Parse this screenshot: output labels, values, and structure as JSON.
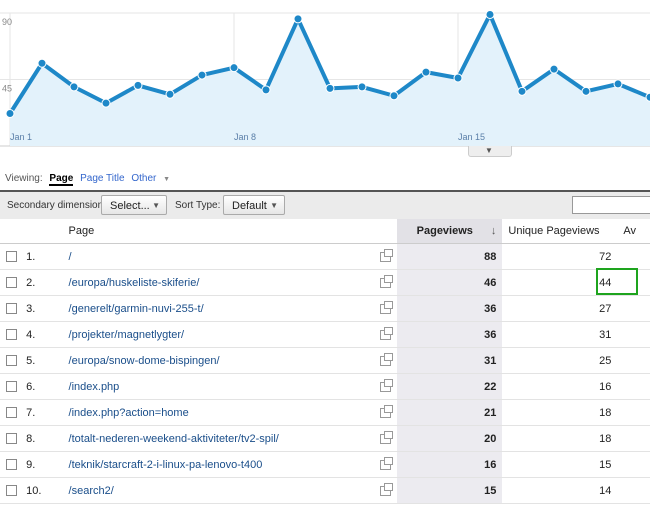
{
  "chart_data": {
    "type": "area",
    "ytick_labels": [
      "90",
      "45"
    ],
    "ylim": [
      0,
      90
    ],
    "xtick_labels": [
      "Jan 1",
      "Jan 8",
      "Jan 15"
    ],
    "values": [
      22,
      56,
      40,
      29,
      41,
      35,
      48,
      53,
      38,
      86,
      39,
      40,
      34,
      50,
      46,
      89,
      37,
      52,
      37,
      42,
      33
    ],
    "colors": {
      "line": "#1e88c8",
      "fill": "#e3f2fb"
    }
  },
  "viewing": {
    "label": "Viewing:",
    "page": "Page",
    "page_title": "Page Title",
    "other": "Other"
  },
  "toolbar": {
    "secondary_label": "Secondary dimension:",
    "secondary_value": "Select...",
    "sort_label": "Sort Type:",
    "sort_value": "Default"
  },
  "table": {
    "headers": {
      "page": "Page",
      "pageviews": "Pageviews",
      "unique": "Unique Pageviews",
      "avg": "Av"
    },
    "rows": [
      {
        "num": "1.",
        "page": "/",
        "pageviews": "88",
        "unique": "72"
      },
      {
        "num": "2.",
        "page": "/europa/huskeliste-skiferie/",
        "pageviews": "46",
        "unique": "44"
      },
      {
        "num": "3.",
        "page": "/generelt/garmin-nuvi-255-t/",
        "pageviews": "36",
        "unique": "27"
      },
      {
        "num": "4.",
        "page": "/projekter/magnetlygter/",
        "pageviews": "36",
        "unique": "31"
      },
      {
        "num": "5.",
        "page": "/europa/snow-dome-bispingen/",
        "pageviews": "31",
        "unique": "25"
      },
      {
        "num": "6.",
        "page": "/index.php",
        "pageviews": "22",
        "unique": "16"
      },
      {
        "num": "7.",
        "page": "/index.php?action=home",
        "pageviews": "21",
        "unique": "18"
      },
      {
        "num": "8.",
        "page": "/totalt-nederen-weekend-aktiviteter/tv2-spil/",
        "pageviews": "20",
        "unique": "18"
      },
      {
        "num": "9.",
        "page": "/teknik/starcraft-2-i-linux-pa-lenovo-t400",
        "pageviews": "16",
        "unique": "15"
      },
      {
        "num": "10.",
        "page": "/search2/",
        "pageviews": "15",
        "unique": "14"
      }
    ]
  }
}
